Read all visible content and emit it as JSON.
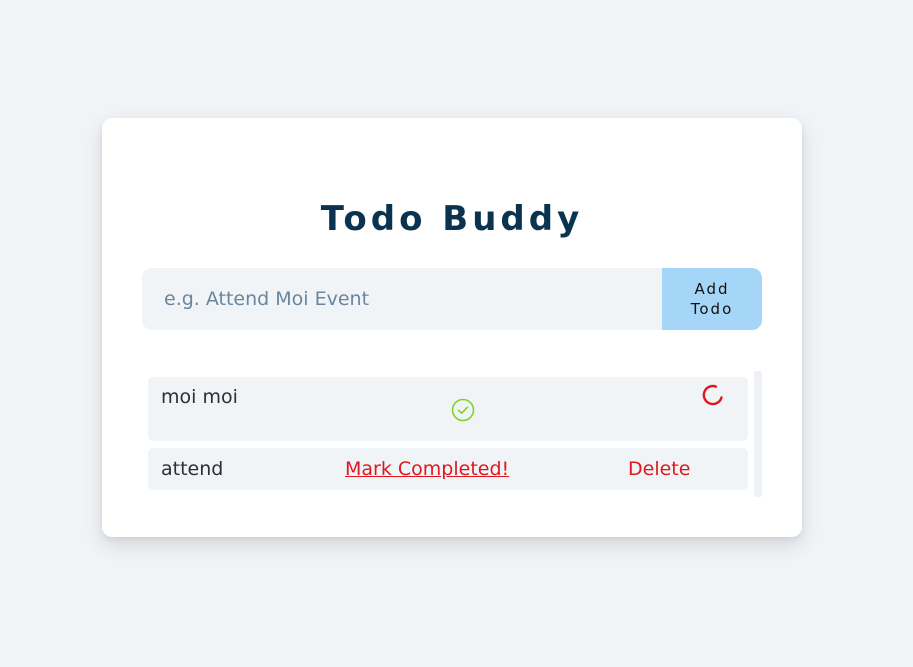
{
  "app": {
    "title": "Todo Buddy"
  },
  "form": {
    "placeholder": "e.g. Attend Moi Event",
    "value": "",
    "add_button_label": "Add Todo"
  },
  "todos": [
    {
      "text": "moi moi",
      "status": "completed",
      "status_icon": "check-circle-icon",
      "action_icon": "loading-spinner-icon"
    },
    {
      "text": "attend",
      "status": "pending",
      "mark_label": "Mark Completed!",
      "delete_label": "Delete"
    }
  ],
  "colors": {
    "background": "#f0f4f7",
    "card": "#ffffff",
    "title": "#0a3350",
    "button": "#a5d6f7",
    "action_red": "#e0181e",
    "check_green": "#7ed321"
  }
}
